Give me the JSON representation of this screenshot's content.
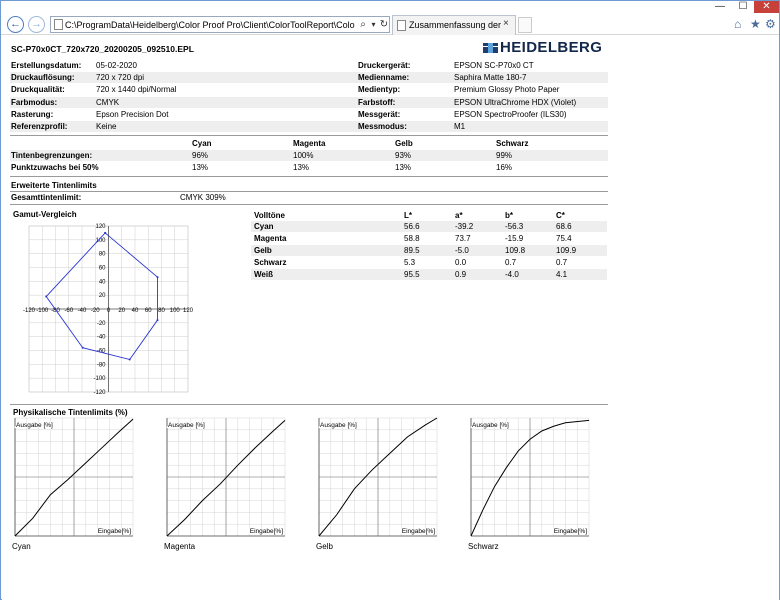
{
  "browser": {
    "address": "C:\\ProgramData\\Heidelberg\\Color Proof Pro\\Client\\ColorToolReport\\Color Tool Report.ht",
    "tab_title": "Zusammenfassung der Kali...",
    "buttons": {
      "minimize": "—",
      "maximize": "☐",
      "close": "✕",
      "back": "←",
      "forward": "→",
      "search": "⌕",
      "dropdown": "▾",
      "refresh": "↻",
      "tab_close": "×"
    },
    "icons": {
      "home": "⌂",
      "star": "★",
      "gear": "⚙"
    }
  },
  "report": {
    "filename": "SC-P70x0CT_720x720_20200205_092510.EPL",
    "logo_text": "HEIDELBERG",
    "info_left": [
      {
        "label": "Erstellungsdatum:",
        "value": "05-02-2020"
      },
      {
        "label": "Druckauflösung:",
        "value": "720 x 720 dpi"
      },
      {
        "label": "Druckqualität:",
        "value": "720 x 1440 dpi/Normal"
      },
      {
        "label": "Farbmodus:",
        "value": "CMYK"
      },
      {
        "label": "Rasterung:",
        "value": "Epson Precision Dot"
      },
      {
        "label": "Referenzprofil:",
        "value": "Keine"
      }
    ],
    "info_right": [
      {
        "label": "Druckergerät:",
        "value": "EPSON SC-P70x0 CT"
      },
      {
        "label": "Medienname:",
        "value": "Saphira Matte 180-7"
      },
      {
        "label": "Medientyp:",
        "value": "Premium Glossy Photo Paper"
      },
      {
        "label": "Farbstoff:",
        "value": "EPSON UltraChrome HDX (Violet)"
      },
      {
        "label": "Messgerät:",
        "value": "EPSON SpectroProofer (ILS30)"
      },
      {
        "label": "Messmodus:",
        "value": "M1"
      }
    ],
    "ink_table": {
      "columns": [
        "Cyan",
        "Magenta",
        "Gelb",
        "Schwarz"
      ],
      "rows": [
        {
          "label": "Tintenbegrenzungen:",
          "values": [
            "96%",
            "100%",
            "93%",
            "99%"
          ]
        },
        {
          "label": "Punktzuwachs bei 50%",
          "values": [
            "13%",
            "13%",
            "13%",
            "16%"
          ]
        }
      ]
    },
    "extended": {
      "title": "Erweiterte Tintenlimits",
      "total_label": "Gesamttintenlimit:",
      "total_value": "CMYK 309%"
    },
    "gamut_title": "Gamut-Vergleich",
    "solids": {
      "headers": [
        "Volltöne",
        "L*",
        "a*",
        "b*",
        "C*"
      ],
      "rows": [
        [
          "Cyan",
          "56.6",
          "-39.2",
          "-56.3",
          "68.6"
        ],
        [
          "Magenta",
          "58.8",
          "73.7",
          "-15.9",
          "75.4"
        ],
        [
          "Gelb",
          "89.5",
          "-5.0",
          "109.8",
          "109.9"
        ],
        [
          "Schwarz",
          "5.3",
          "0.0",
          "0.7",
          "0.7"
        ],
        [
          "Weiß",
          "95.5",
          "0.9",
          "-4.0",
          "4.1"
        ]
      ]
    },
    "physical_title": "Physikalische Tintenlimits (%)",
    "curve_axis": {
      "y": "Ausgabe [%]",
      "x": "Eingabe[%]"
    },
    "curves": [
      {
        "name": "Cyan",
        "points": [
          [
            0,
            0
          ],
          [
            15,
            15
          ],
          [
            30,
            35
          ],
          [
            45,
            48
          ],
          [
            60,
            62
          ],
          [
            75,
            76
          ],
          [
            90,
            90
          ],
          [
            100,
            99
          ]
        ]
      },
      {
        "name": "Magenta",
        "points": [
          [
            0,
            0
          ],
          [
            15,
            14
          ],
          [
            30,
            30
          ],
          [
            45,
            44
          ],
          [
            60,
            60
          ],
          [
            75,
            75
          ],
          [
            90,
            89
          ],
          [
            100,
            98
          ]
        ]
      },
      {
        "name": "Gelb",
        "points": [
          [
            0,
            0
          ],
          [
            15,
            18
          ],
          [
            30,
            40
          ],
          [
            45,
            56
          ],
          [
            60,
            70
          ],
          [
            75,
            84
          ],
          [
            90,
            94
          ],
          [
            100,
            100
          ]
        ]
      },
      {
        "name": "Schwarz",
        "points": [
          [
            0,
            0
          ],
          [
            10,
            22
          ],
          [
            20,
            42
          ],
          [
            30,
            58
          ],
          [
            40,
            72
          ],
          [
            50,
            82
          ],
          [
            60,
            89
          ],
          [
            70,
            93
          ],
          [
            80,
            96
          ],
          [
            100,
            98
          ]
        ]
      }
    ]
  },
  "chart_data": [
    {
      "type": "scatter",
      "title": "Gamut-Vergleich",
      "xlim": [
        -120,
        120
      ],
      "ylim": [
        -120,
        120
      ],
      "x_ticks": [
        -120,
        -100,
        -80,
        -60,
        -40,
        -20,
        0,
        20,
        40,
        60,
        80,
        100,
        120
      ],
      "y_ticks": [
        120,
        100,
        80,
        60,
        40,
        20,
        0,
        -20,
        -40,
        -60,
        -80,
        -100,
        -120
      ],
      "grid": true,
      "series": [
        {
          "values": [
            [
              -5,
              110
            ],
            [
              74,
              46
            ],
            [
              74,
              -16
            ],
            [
              32,
              -73
            ],
            [
              -39,
              -56
            ],
            [
              -94,
              18
            ],
            [
              -5,
              110
            ]
          ]
        }
      ]
    },
    {
      "type": "line",
      "series": [
        {
          "name": "Cyan",
          "values": [
            [
              0,
              0
            ],
            [
              15,
              15
            ],
            [
              30,
              35
            ],
            [
              45,
              48
            ],
            [
              60,
              62
            ],
            [
              75,
              76
            ],
            [
              90,
              90
            ],
            [
              100,
              99
            ]
          ]
        },
        {
          "name": "Magenta",
          "values": [
            [
              0,
              0
            ],
            [
              15,
              14
            ],
            [
              30,
              30
            ],
            [
              45,
              44
            ],
            [
              60,
              60
            ],
            [
              75,
              75
            ],
            [
              90,
              89
            ],
            [
              100,
              98
            ]
          ]
        },
        {
          "name": "Gelb",
          "values": [
            [
              0,
              0
            ],
            [
              15,
              18
            ],
            [
              30,
              40
            ],
            [
              45,
              56
            ],
            [
              60,
              70
            ],
            [
              75,
              84
            ],
            [
              90,
              94
            ],
            [
              100,
              100
            ]
          ]
        },
        {
          "name": "Schwarz",
          "values": [
            [
              0,
              0
            ],
            [
              10,
              22
            ],
            [
              20,
              42
            ],
            [
              30,
              58
            ],
            [
              40,
              72
            ],
            [
              50,
              82
            ],
            [
              60,
              89
            ],
            [
              70,
              93
            ],
            [
              80,
              96
            ],
            [
              100,
              98
            ]
          ]
        }
      ],
      "xlabel": "Eingabe[%]",
      "ylabel": "Ausgabe [%]",
      "xlim": [
        0,
        100
      ],
      "ylim": [
        0,
        100
      ],
      "grid": true
    }
  ]
}
